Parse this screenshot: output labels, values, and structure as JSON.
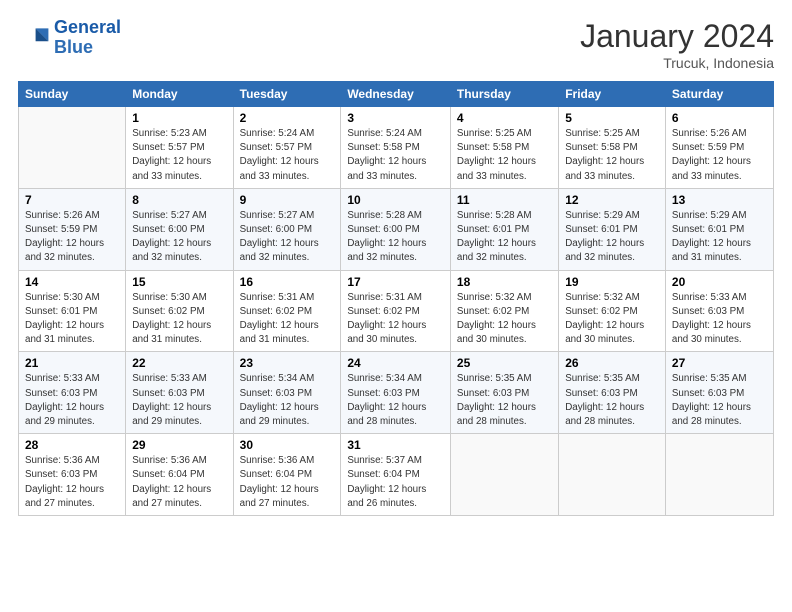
{
  "logo": {
    "line1": "General",
    "line2": "Blue"
  },
  "title": "January 2024",
  "location": "Trucuk, Indonesia",
  "days_header": [
    "Sunday",
    "Monday",
    "Tuesday",
    "Wednesday",
    "Thursday",
    "Friday",
    "Saturday"
  ],
  "weeks": [
    [
      {
        "num": "",
        "info": ""
      },
      {
        "num": "1",
        "info": "Sunrise: 5:23 AM\nSunset: 5:57 PM\nDaylight: 12 hours\nand 33 minutes."
      },
      {
        "num": "2",
        "info": "Sunrise: 5:24 AM\nSunset: 5:57 PM\nDaylight: 12 hours\nand 33 minutes."
      },
      {
        "num": "3",
        "info": "Sunrise: 5:24 AM\nSunset: 5:58 PM\nDaylight: 12 hours\nand 33 minutes."
      },
      {
        "num": "4",
        "info": "Sunrise: 5:25 AM\nSunset: 5:58 PM\nDaylight: 12 hours\nand 33 minutes."
      },
      {
        "num": "5",
        "info": "Sunrise: 5:25 AM\nSunset: 5:58 PM\nDaylight: 12 hours\nand 33 minutes."
      },
      {
        "num": "6",
        "info": "Sunrise: 5:26 AM\nSunset: 5:59 PM\nDaylight: 12 hours\nand 33 minutes."
      }
    ],
    [
      {
        "num": "7",
        "info": "Sunrise: 5:26 AM\nSunset: 5:59 PM\nDaylight: 12 hours\nand 32 minutes."
      },
      {
        "num": "8",
        "info": "Sunrise: 5:27 AM\nSunset: 6:00 PM\nDaylight: 12 hours\nand 32 minutes."
      },
      {
        "num": "9",
        "info": "Sunrise: 5:27 AM\nSunset: 6:00 PM\nDaylight: 12 hours\nand 32 minutes."
      },
      {
        "num": "10",
        "info": "Sunrise: 5:28 AM\nSunset: 6:00 PM\nDaylight: 12 hours\nand 32 minutes."
      },
      {
        "num": "11",
        "info": "Sunrise: 5:28 AM\nSunset: 6:01 PM\nDaylight: 12 hours\nand 32 minutes."
      },
      {
        "num": "12",
        "info": "Sunrise: 5:29 AM\nSunset: 6:01 PM\nDaylight: 12 hours\nand 32 minutes."
      },
      {
        "num": "13",
        "info": "Sunrise: 5:29 AM\nSunset: 6:01 PM\nDaylight: 12 hours\nand 31 minutes."
      }
    ],
    [
      {
        "num": "14",
        "info": "Sunrise: 5:30 AM\nSunset: 6:01 PM\nDaylight: 12 hours\nand 31 minutes."
      },
      {
        "num": "15",
        "info": "Sunrise: 5:30 AM\nSunset: 6:02 PM\nDaylight: 12 hours\nand 31 minutes."
      },
      {
        "num": "16",
        "info": "Sunrise: 5:31 AM\nSunset: 6:02 PM\nDaylight: 12 hours\nand 31 minutes."
      },
      {
        "num": "17",
        "info": "Sunrise: 5:31 AM\nSunset: 6:02 PM\nDaylight: 12 hours\nand 30 minutes."
      },
      {
        "num": "18",
        "info": "Sunrise: 5:32 AM\nSunset: 6:02 PM\nDaylight: 12 hours\nand 30 minutes."
      },
      {
        "num": "19",
        "info": "Sunrise: 5:32 AM\nSunset: 6:02 PM\nDaylight: 12 hours\nand 30 minutes."
      },
      {
        "num": "20",
        "info": "Sunrise: 5:33 AM\nSunset: 6:03 PM\nDaylight: 12 hours\nand 30 minutes."
      }
    ],
    [
      {
        "num": "21",
        "info": "Sunrise: 5:33 AM\nSunset: 6:03 PM\nDaylight: 12 hours\nand 29 minutes."
      },
      {
        "num": "22",
        "info": "Sunrise: 5:33 AM\nSunset: 6:03 PM\nDaylight: 12 hours\nand 29 minutes."
      },
      {
        "num": "23",
        "info": "Sunrise: 5:34 AM\nSunset: 6:03 PM\nDaylight: 12 hours\nand 29 minutes."
      },
      {
        "num": "24",
        "info": "Sunrise: 5:34 AM\nSunset: 6:03 PM\nDaylight: 12 hours\nand 28 minutes."
      },
      {
        "num": "25",
        "info": "Sunrise: 5:35 AM\nSunset: 6:03 PM\nDaylight: 12 hours\nand 28 minutes."
      },
      {
        "num": "26",
        "info": "Sunrise: 5:35 AM\nSunset: 6:03 PM\nDaylight: 12 hours\nand 28 minutes."
      },
      {
        "num": "27",
        "info": "Sunrise: 5:35 AM\nSunset: 6:03 PM\nDaylight: 12 hours\nand 28 minutes."
      }
    ],
    [
      {
        "num": "28",
        "info": "Sunrise: 5:36 AM\nSunset: 6:03 PM\nDaylight: 12 hours\nand 27 minutes."
      },
      {
        "num": "29",
        "info": "Sunrise: 5:36 AM\nSunset: 6:04 PM\nDaylight: 12 hours\nand 27 minutes."
      },
      {
        "num": "30",
        "info": "Sunrise: 5:36 AM\nSunset: 6:04 PM\nDaylight: 12 hours\nand 27 minutes."
      },
      {
        "num": "31",
        "info": "Sunrise: 5:37 AM\nSunset: 6:04 PM\nDaylight: 12 hours\nand 26 minutes."
      },
      {
        "num": "",
        "info": ""
      },
      {
        "num": "",
        "info": ""
      },
      {
        "num": "",
        "info": ""
      }
    ]
  ]
}
